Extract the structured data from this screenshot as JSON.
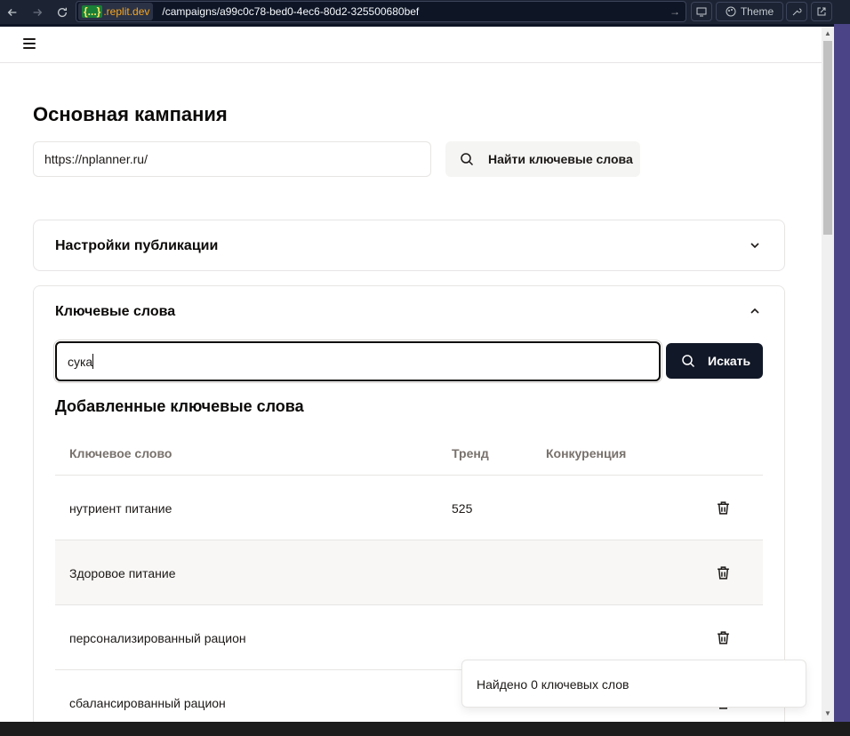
{
  "browser": {
    "host_badge": "{...}",
    "host": ".replit.dev",
    "path": "/campaigns/a99c0c78-bed0-4ec6-80d2-325500680bef",
    "theme_label": "Theme"
  },
  "page": {
    "title": "Основная кампания",
    "url_value": "https://nplanner.ru/",
    "find_button": "Найти ключевые слова"
  },
  "publication": {
    "title": "Настройки публикации"
  },
  "keywords": {
    "title": "Ключевые слова",
    "input_value": "сука",
    "search_button": "Искать",
    "added_title": "Добавленные ключевые слова",
    "columns": {
      "keyword": "Ключевое слово",
      "trend": "Тренд",
      "competition": "Конкуренция"
    },
    "rows": [
      {
        "keyword": "нутриент питание",
        "trend": "525",
        "competition": ""
      },
      {
        "keyword": "Здоровое питание",
        "trend": "",
        "competition": ""
      },
      {
        "keyword": "персонализированный рацион",
        "trend": "",
        "competition": ""
      },
      {
        "keyword": "сбалансированный рацион",
        "trend": "",
        "competition": ""
      }
    ]
  },
  "toast": {
    "message": "Найдено 0 ключевых слов"
  },
  "colors": {
    "primary_button": "#111827",
    "border": "#e7e5e4",
    "muted_text": "#78716c"
  }
}
